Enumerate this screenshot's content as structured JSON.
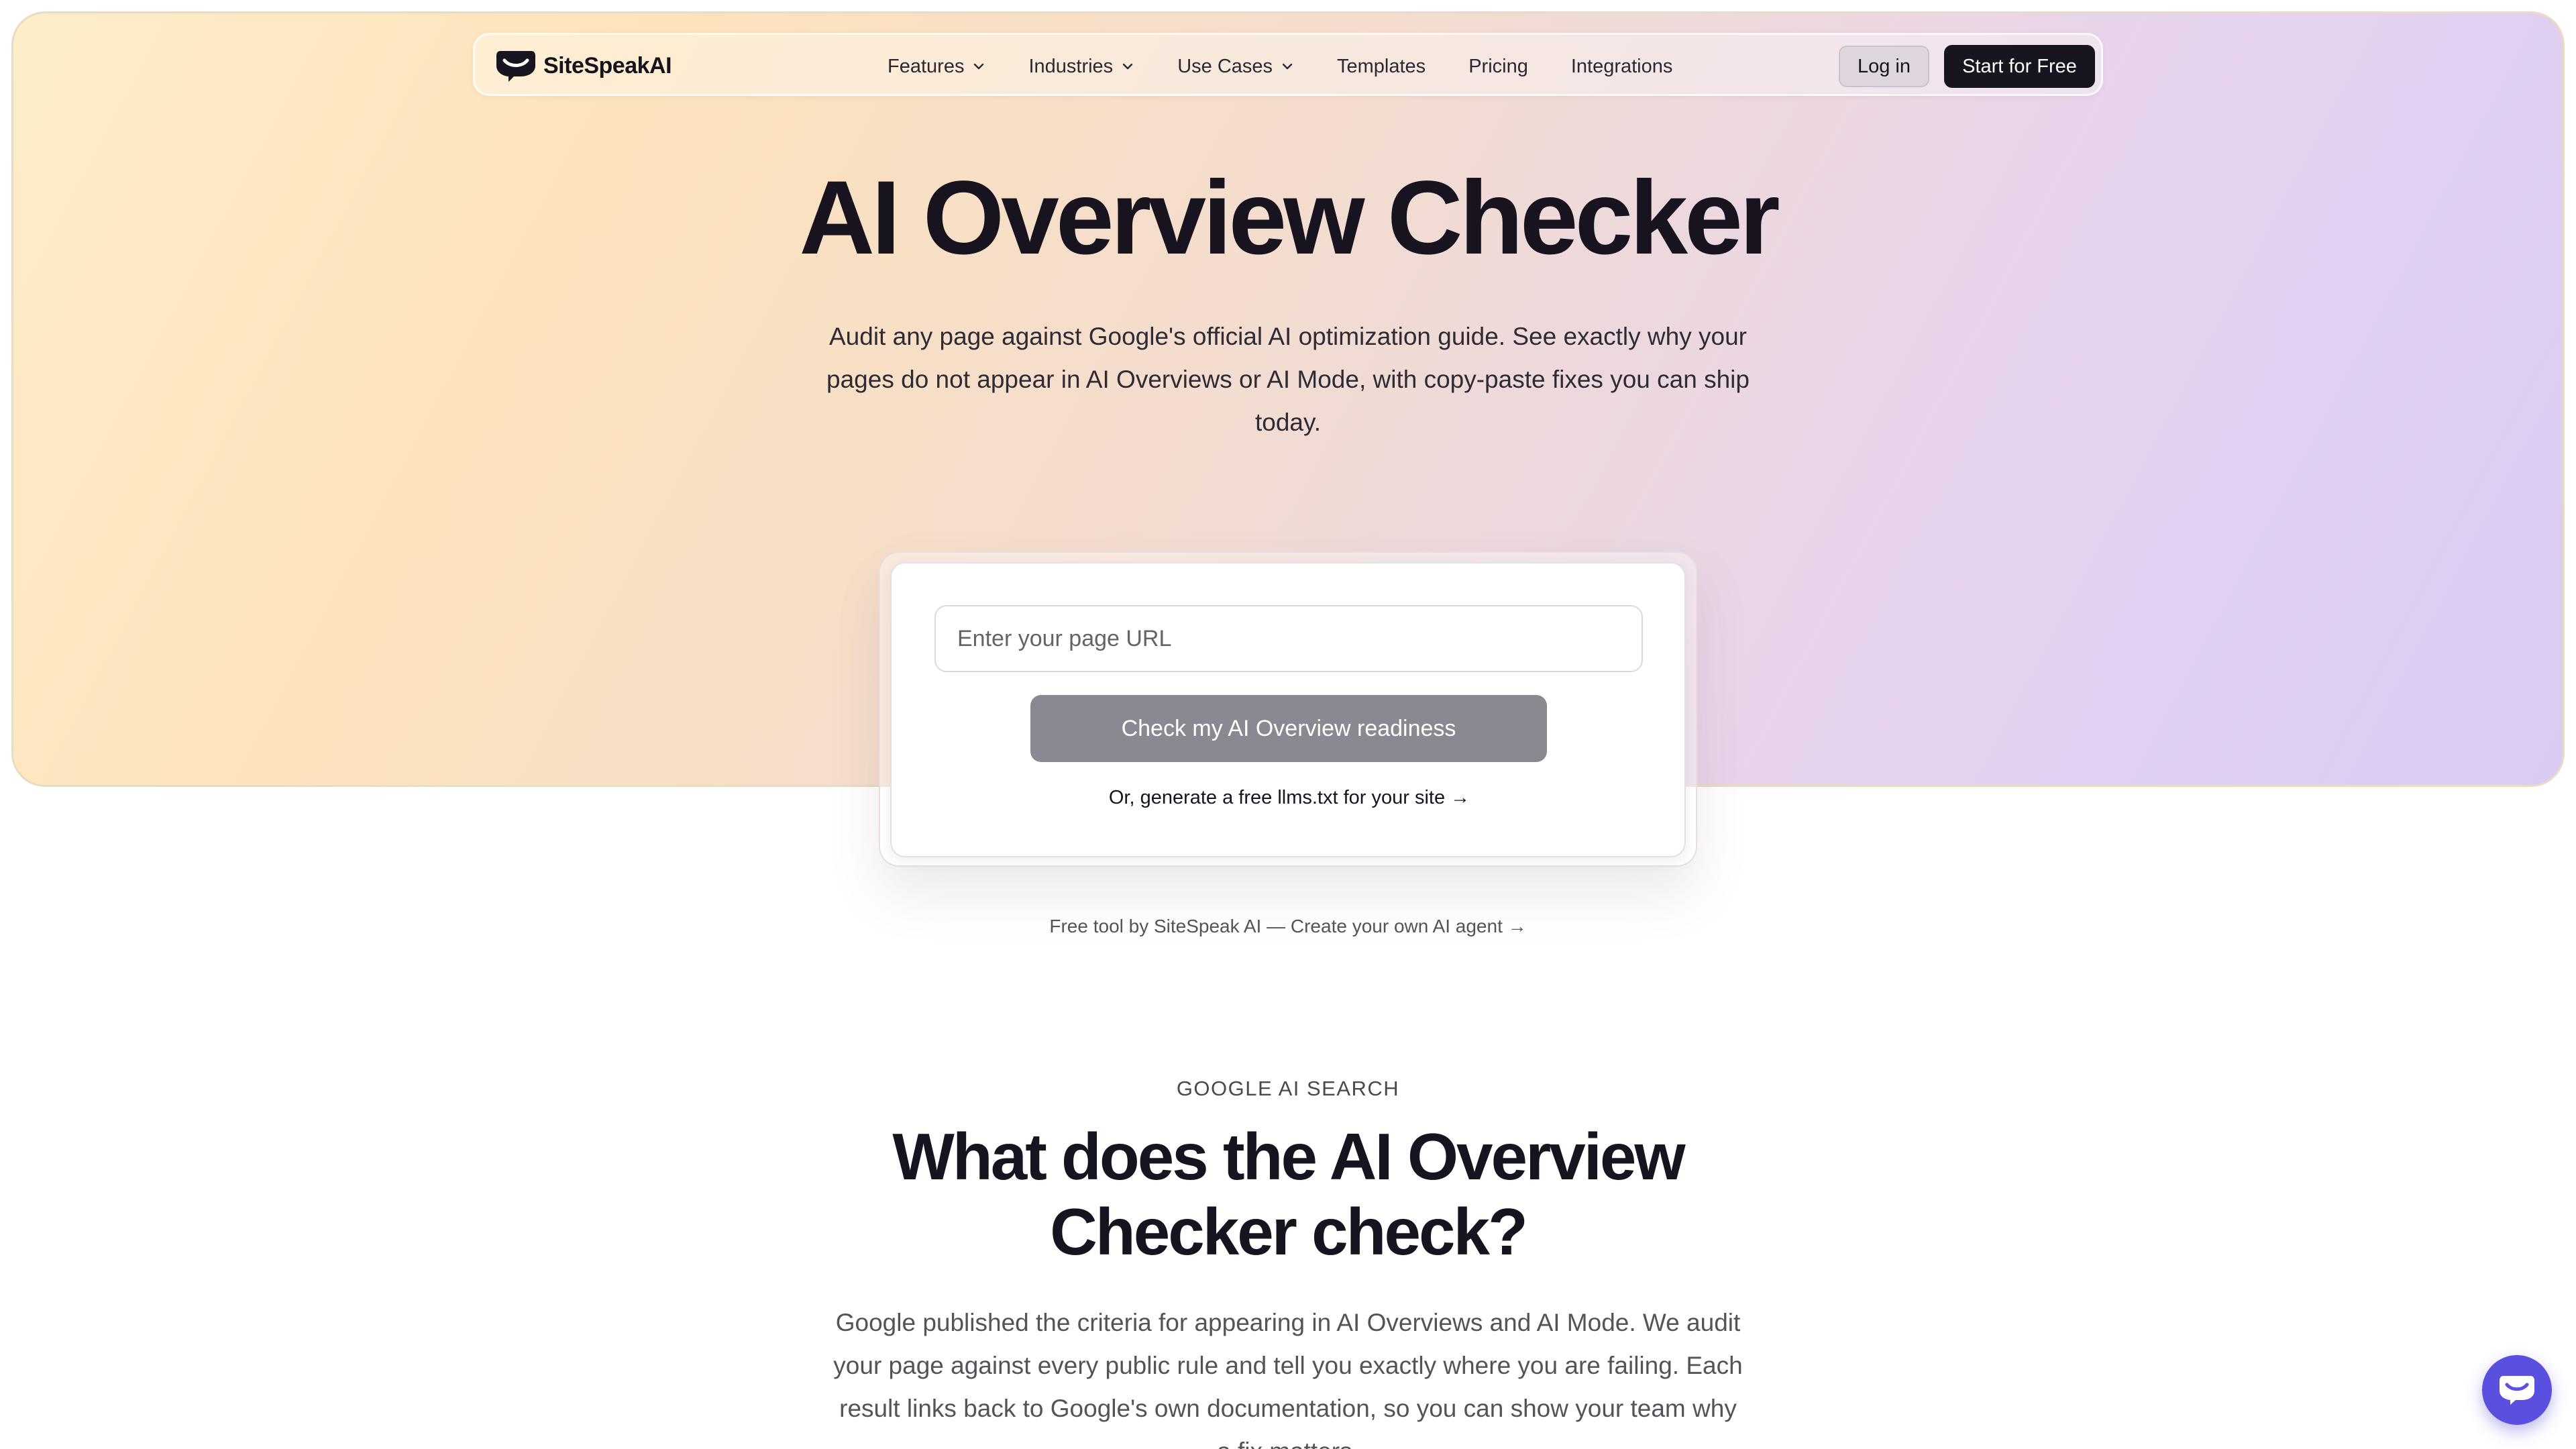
{
  "colors": {
    "hero_gradient_start": "#fdeec8",
    "hero_gradient_end": "#d9cbf3",
    "primary_dark": "#17151f",
    "check_button": "#8a8890",
    "chat_widget": "#5b4fe0"
  },
  "nav": {
    "brand": {
      "icon": "sitespeak-logo-icon",
      "name": "SiteSpeakAI"
    },
    "links": [
      {
        "label": "Features",
        "has_dropdown": true
      },
      {
        "label": "Industries",
        "has_dropdown": true
      },
      {
        "label": "Use Cases",
        "has_dropdown": true
      },
      {
        "label": "Templates",
        "has_dropdown": false
      },
      {
        "label": "Pricing",
        "has_dropdown": false
      },
      {
        "label": "Integrations",
        "has_dropdown": false
      }
    ],
    "login_label": "Log in",
    "start_label": "Start for Free"
  },
  "hero": {
    "title": "AI Overview Checker",
    "subtitle": "Audit any page against Google's official AI optimization guide. See exactly why your pages do not appear in AI Overviews or AI Mode, with copy-paste fixes you can ship today."
  },
  "form": {
    "url_placeholder": "Enter your page URL",
    "url_value": "",
    "check_button_label": "Check my AI Overview readiness",
    "llms_link": "Or, generate a free llms.txt for your site →"
  },
  "free_tool_note": "Free tool by SiteSpeak AI — Create your own AI agent →",
  "section": {
    "eyebrow": "GOOGLE AI SEARCH",
    "title": "What does the AI Overview Checker check?",
    "body": "Google published the criteria for appearing in AI Overviews and AI Mode. We audit your page against every public rule and tell you exactly where you are failing. Each result links back to Google's own documentation, so you can show your team why a fix matters."
  },
  "chat_widget": {
    "icon": "chat-bubble-icon"
  }
}
